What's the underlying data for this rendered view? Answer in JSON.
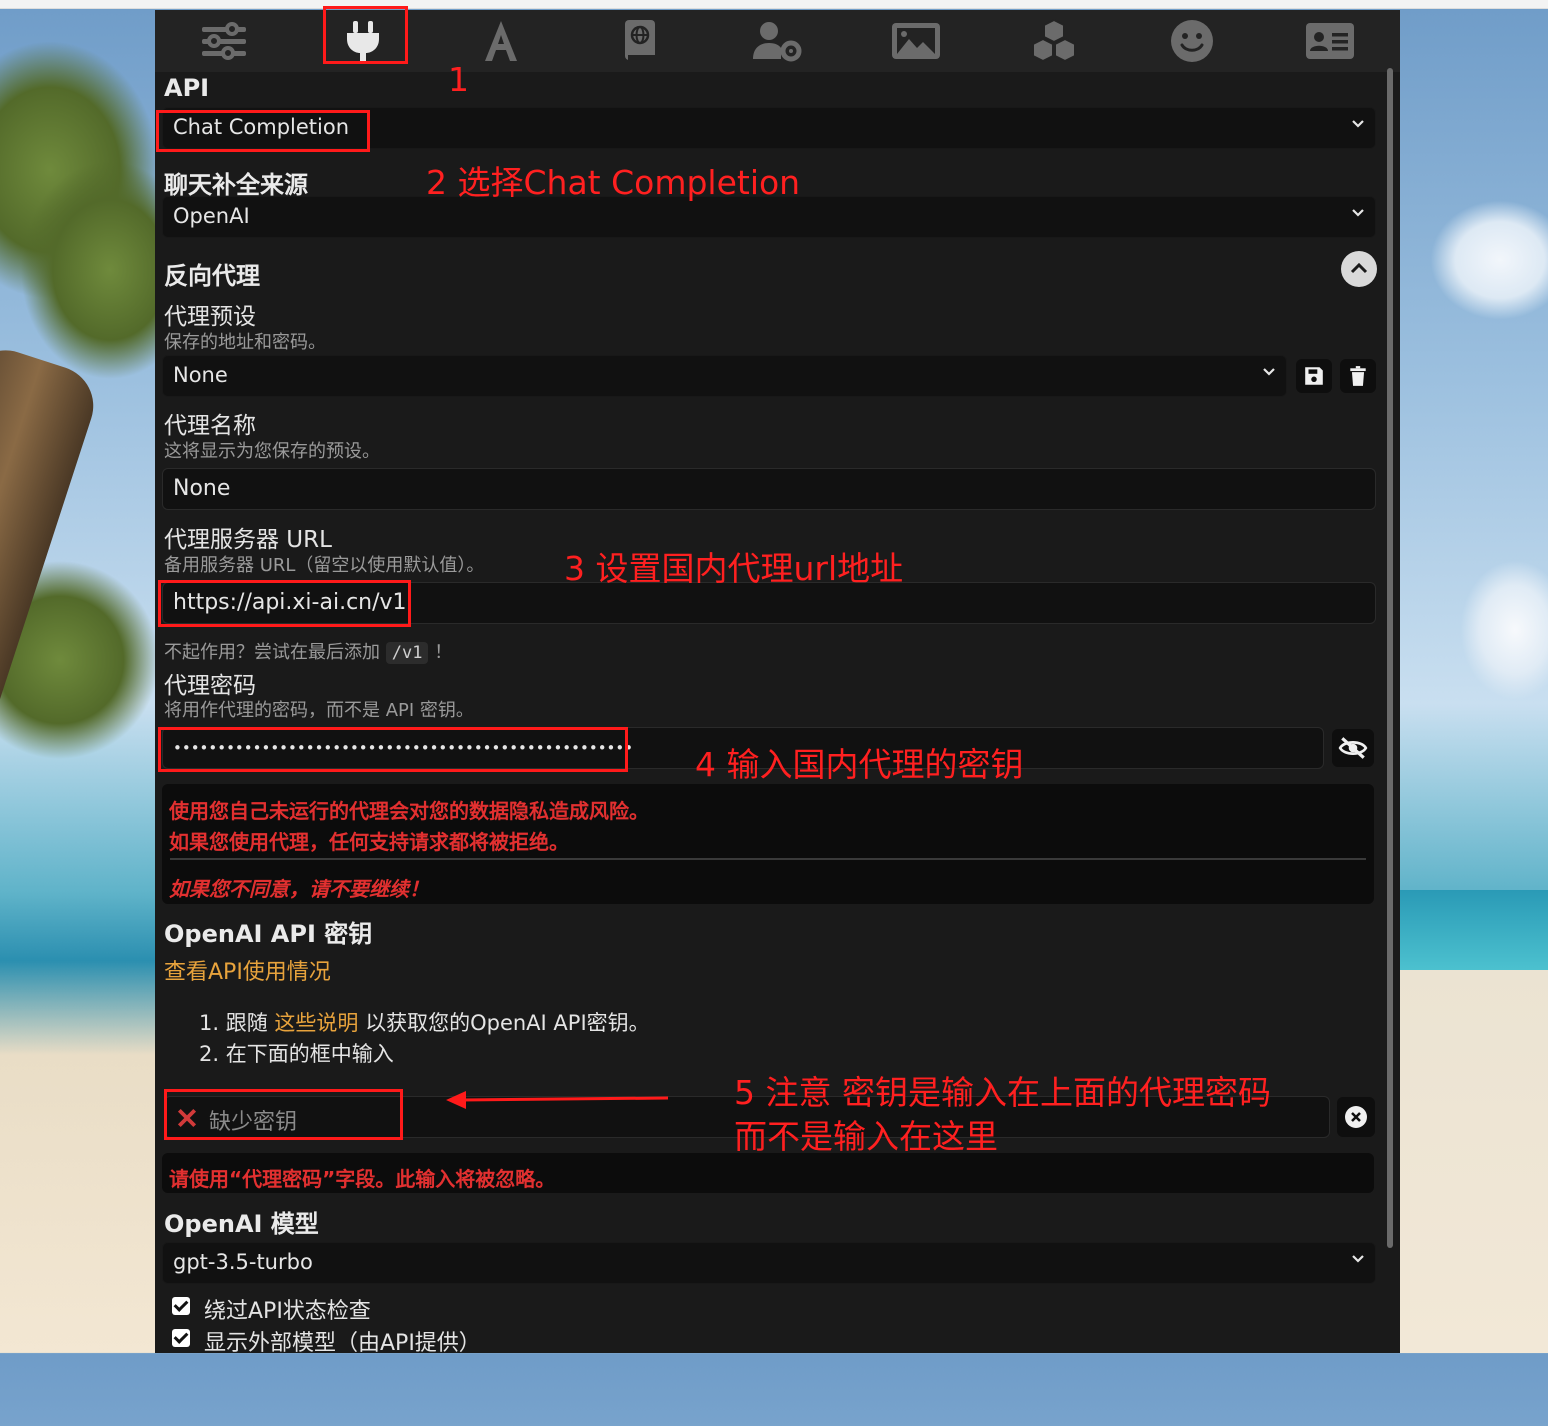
{
  "tabs": [
    {
      "icon": "sliders-icon"
    },
    {
      "icon": "plug-icon"
    },
    {
      "icon": "font-a-icon"
    },
    {
      "icon": "book-globe-icon"
    },
    {
      "icon": "user-gear-icon"
    },
    {
      "icon": "image-icon"
    },
    {
      "icon": "cubes-icon"
    },
    {
      "icon": "smile-icon"
    },
    {
      "icon": "id-card-icon"
    }
  ],
  "api": {
    "label": "API",
    "selected": "Chat Completion"
  },
  "source": {
    "label": "聊天补全来源",
    "selected": "OpenAI"
  },
  "reverse_proxy": {
    "label": "反向代理",
    "preset_label": "代理预设",
    "preset_hint": "保存的地址和密码。",
    "preset_selected": "None",
    "name_label": "代理名称",
    "name_hint": "这将显示为您保存的预设。",
    "name_value": "None",
    "url_label": "代理服务器 URL",
    "url_hint": "备用服务器 URL（留空以使用默认值）。",
    "url_value": "https://api.xi-ai.cn/v1",
    "url_tip_before": "不起作用？尝试在最后添加",
    "url_tip_code": "/v1",
    "url_tip_after": "！",
    "password_label": "代理密码",
    "password_hint": "将用作代理的密码，而不是 API 密钥。",
    "password_value": "••••••••••••••••••••••••••••••••••••••••••••••••••••"
  },
  "warning": {
    "line1": "使用您自己未运行的代理会对您的数据隐私造成风险。",
    "line2": "如果您使用代理，任何支持请求都将被拒绝。",
    "line3": "如果您不同意，请不要继续！"
  },
  "openai_key": {
    "label": "OpenAI API 密钥",
    "usage_link": "查看API使用情况",
    "step1_before": "1. 跟随",
    "step1_link": "这些说明",
    "step1_after": "以获取您的OpenAI API密钥。",
    "step2": "2. 在下面的框中输入",
    "placeholder": "缺少密钥",
    "note": "请使用“代理密码”字段。此输入将被忽略。"
  },
  "model": {
    "label": "OpenAI 模型",
    "selected": "gpt-3.5-turbo"
  },
  "checkboxes": [
    {
      "label": "绕过API状态检查",
      "checked": true
    },
    {
      "label": "显示外部模型（由API提供）",
      "checked": true
    }
  ],
  "annotations": {
    "a1": "1",
    "a2": "2 选择Chat Completion",
    "a3": "3 设置国内代理url地址",
    "a4": "4 输入国内代理的密钥",
    "a5_line1": "5 注意 密钥是输入在上面的代理密码",
    "a5_line2": "而不是输入在这里"
  },
  "colors": {
    "annotation": "#ff1a1a",
    "warning_text": "#e23030",
    "link": "#e8a33c",
    "panel_bg": "#1a1a1a"
  }
}
